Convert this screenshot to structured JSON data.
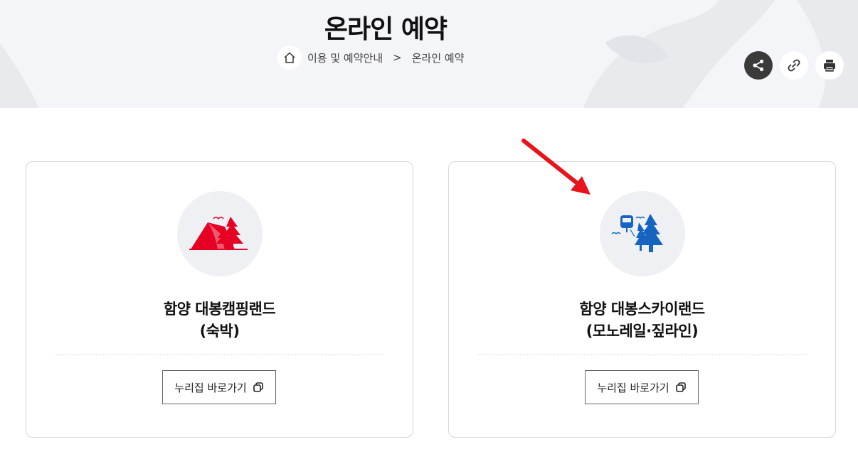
{
  "header": {
    "title": "온라인 예약"
  },
  "breadcrumb": {
    "items": [
      "이용 및 예약안내",
      "온라인 예약"
    ],
    "separator": ">"
  },
  "tools": {
    "share": "share-icon",
    "link": "link-icon",
    "print": "print-icon"
  },
  "cards": [
    {
      "title_line1": "함양 대봉캠핑랜드",
      "title_line2": "(숙박)",
      "button_label": "누리집 바로가기",
      "icon": "tent-trees-icon",
      "color": "#e60023"
    },
    {
      "title_line1": "함양 대봉스카이랜드",
      "title_line2": "(모노레일·짚라인)",
      "button_label": "누리집 바로가기",
      "icon": "monorail-trees-icon",
      "color": "#1565c0"
    }
  ],
  "colors": {
    "header_bg": "#f4f5f8",
    "arrow": "#e8141b",
    "dark_button": "#3a3a3a"
  }
}
